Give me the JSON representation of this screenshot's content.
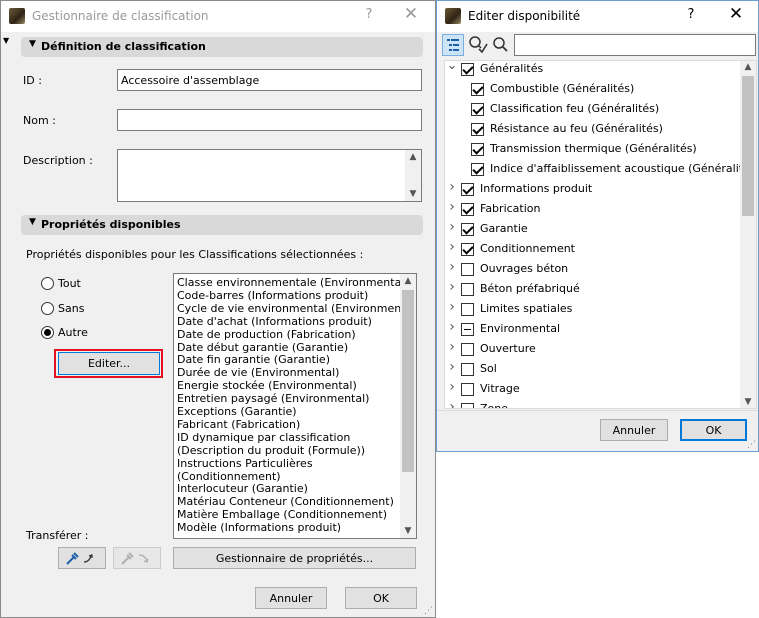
{
  "left_dialog": {
    "title": "Gestionnaire de classification",
    "help": "?",
    "close": "✕",
    "section_definition": "Définition de classification",
    "id_label": "ID :",
    "id_value": "Accessoire d'assemblage",
    "nom_label": "Nom :",
    "nom_value": "",
    "description_label": "Description :",
    "description_value": "",
    "section_properties": "Propriétés disponibles",
    "properties_caption": "Propriétés disponibles pour les Classifications sélectionnées :",
    "radios": [
      {
        "label": "Tout",
        "selected": false
      },
      {
        "label": "Sans",
        "selected": false
      },
      {
        "label": "Autre",
        "selected": true
      }
    ],
    "edit_button": "Editer...",
    "properties_list": [
      "Classe environnementale (Environmental)",
      "Code-barres (Informations produit)",
      "Cycle de vie environmental (Environmental)",
      "Date d'achat (Informations produit)",
      "Date de production (Fabrication)",
      "Date début garantie (Garantie)",
      "Date fin garantie (Garantie)",
      "Durée de vie (Environmental)",
      "Energie stockée (Environmental)",
      "Entretien paysagé (Environmental)",
      "Exceptions (Garantie)",
      "Fabricant (Fabrication)",
      "ID dynamique par classification",
      "(Description du produit (Formule))",
      "Instructions Particulières",
      "(Conditionnement)",
      "Interlocuteur (Garantie)",
      "Matériau Conteneur (Conditionnement)",
      "Matière Emballage (Conditionnement)",
      "Modèle (Informations produit)"
    ],
    "transfer_label": "Transférer :",
    "property_manager_button": "Gestionnaire de propriétés...",
    "cancel_button": "Annuler",
    "ok_button": "OK"
  },
  "right_dialog": {
    "title": "Editer disponibilité",
    "help": "?",
    "close": "✕",
    "search_value": "",
    "tree": [
      {
        "label": "Généralités",
        "level": 0,
        "expanded": true,
        "state": "checked"
      },
      {
        "label": "Combustible (Généralités)",
        "level": 1,
        "state": "checked"
      },
      {
        "label": "Classification feu (Généralités)",
        "level": 1,
        "state": "checked"
      },
      {
        "label": "Résistance au feu (Généralités)",
        "level": 1,
        "state": "checked"
      },
      {
        "label": "Transmission thermique (Généralités)",
        "level": 1,
        "state": "checked"
      },
      {
        "label": "Indice d'affaiblissement acoustique (Généralités)",
        "level": 1,
        "state": "checked"
      },
      {
        "label": "Informations produit",
        "level": 0,
        "expanded": false,
        "state": "checked"
      },
      {
        "label": "Fabrication",
        "level": 0,
        "expanded": false,
        "state": "checked"
      },
      {
        "label": "Garantie",
        "level": 0,
        "expanded": false,
        "state": "checked"
      },
      {
        "label": "Conditionnement",
        "level": 0,
        "expanded": false,
        "state": "checked"
      },
      {
        "label": "Ouvrages béton",
        "level": 0,
        "expanded": false,
        "state": "unchecked"
      },
      {
        "label": "Béton préfabriqué",
        "level": 0,
        "expanded": false,
        "state": "unchecked"
      },
      {
        "label": "Limites spatiales",
        "level": 0,
        "expanded": false,
        "state": "unchecked"
      },
      {
        "label": "Environmental",
        "level": 0,
        "expanded": false,
        "state": "partial"
      },
      {
        "label": "Ouverture",
        "level": 0,
        "expanded": false,
        "state": "unchecked"
      },
      {
        "label": "Sol",
        "level": 0,
        "expanded": false,
        "state": "unchecked"
      },
      {
        "label": "Vitrage",
        "level": 0,
        "expanded": false,
        "state": "unchecked"
      },
      {
        "label": "Zone",
        "level": 0,
        "expanded": false,
        "state": "unchecked"
      }
    ],
    "cancel_button": "Annuler",
    "ok_button": "OK"
  },
  "colors": {
    "accent": "#0078d7",
    "highlight_border": "#e81123"
  }
}
